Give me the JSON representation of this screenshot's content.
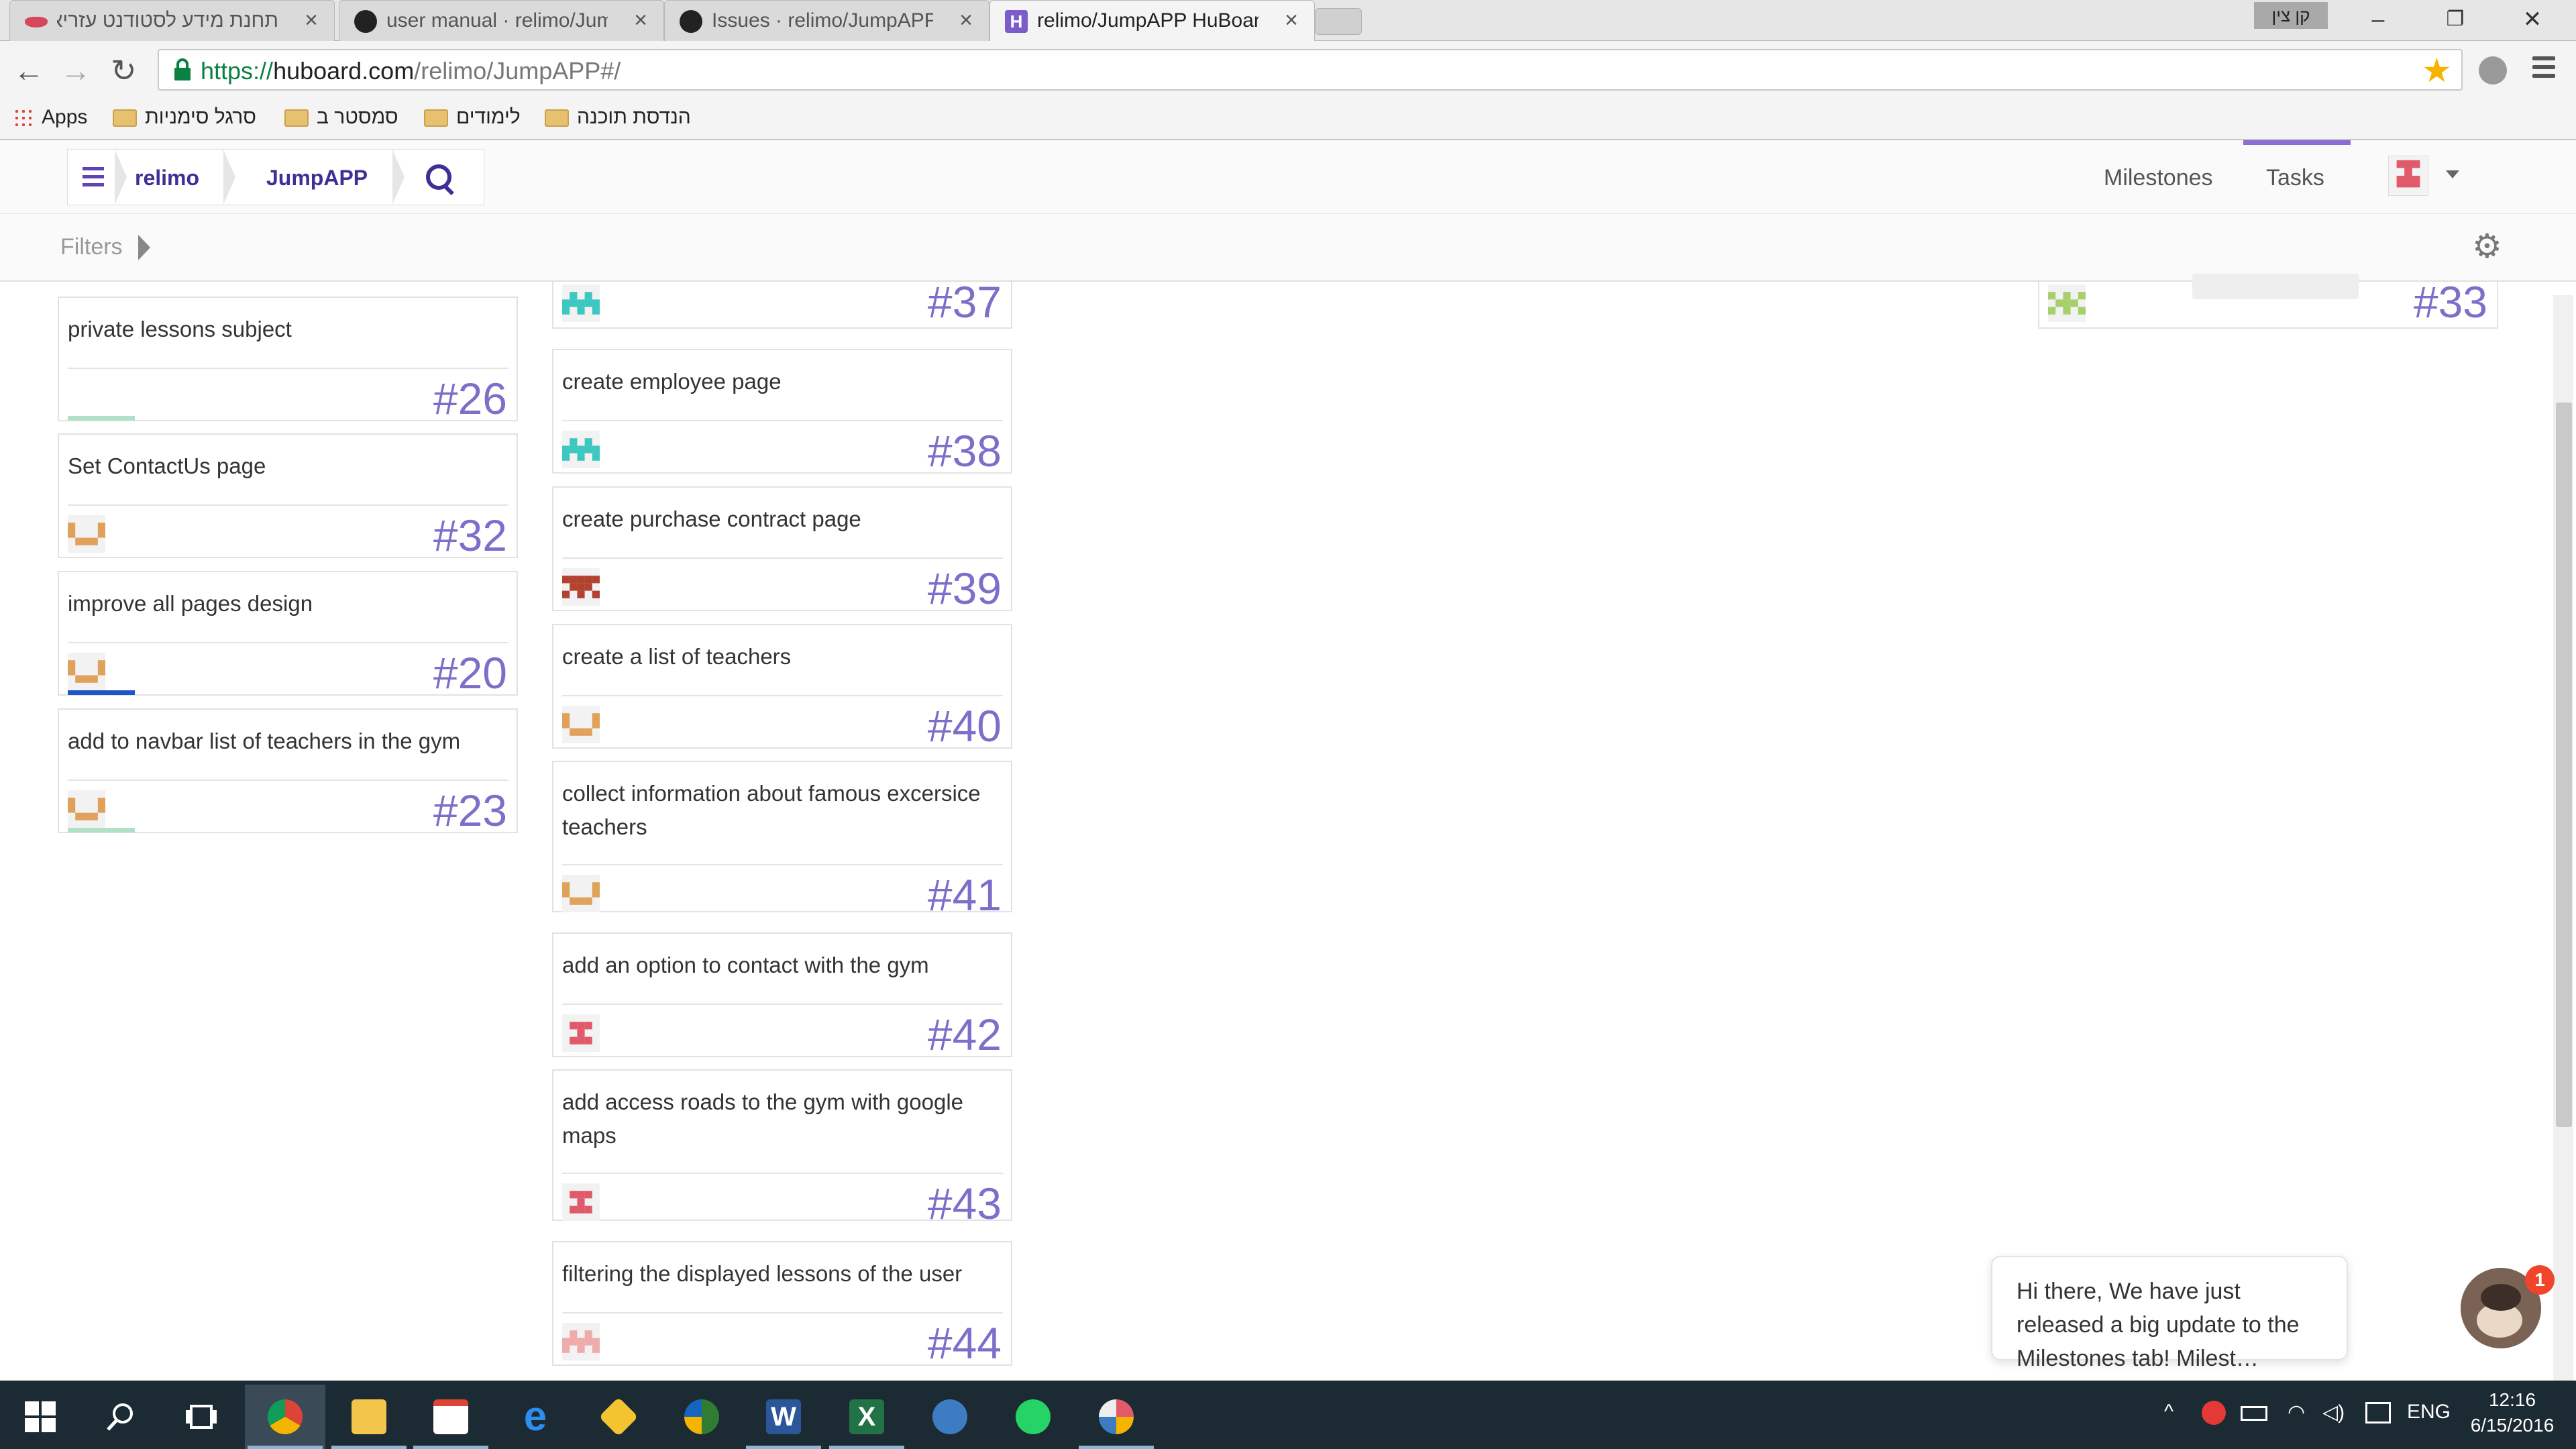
{
  "browser": {
    "tabs": [
      {
        "title": "תחנת מידע לסטודנט עזריא",
        "icon_color": "#d6475c"
      },
      {
        "title": "user manual · relimo/Jump",
        "icon_color": "#222222"
      },
      {
        "title": "Issues · relimo/JumpAPP",
        "icon_color": "#222222"
      },
      {
        "title": "relimo/JumpAPP HuBoard",
        "icon_color": "#7b5cc9"
      }
    ],
    "tab_close": "×",
    "profile_name": "קן צין",
    "window_buttons": {
      "minimize": "–",
      "restore": "❐",
      "close": "✕"
    },
    "nav": {
      "back": "←",
      "forward": "→",
      "reload": "↻"
    },
    "url": {
      "protocol": "https://",
      "host": "huboard.com",
      "path": "/relimo/JumpAPP#/"
    },
    "star": "★",
    "bookmarks": [
      {
        "label": "Apps"
      },
      {
        "label": "סרגל סימניות"
      },
      {
        "label": "סמסטר ב"
      },
      {
        "label": "לימודים"
      },
      {
        "label": "הנדסת תוכנה"
      }
    ]
  },
  "app": {
    "breadcrumb": {
      "owner": "relimo",
      "repo": "JumpAPP"
    },
    "nav": {
      "milestones": "Milestones",
      "tasks": "Tasks"
    },
    "filters_label": "Filters",
    "gear": "⚙",
    "accent": "#7e6ec9"
  },
  "board": {
    "column1": [
      {
        "title": "private lessons subject",
        "number": "#26",
        "avatar": "none",
        "bar_color": "#b2e0c6"
      },
      {
        "title": "Set ContactUs page",
        "number": "#32",
        "avatar": "orange",
        "bar_color": ""
      },
      {
        "title": "improve all pages design",
        "number": "#20",
        "avatar": "orange",
        "bar_color": "#1e55c8"
      },
      {
        "title": "add to navbar list of teachers in the gym",
        "number": "#23",
        "avatar": "orange",
        "bar_color": "#b2e0c6"
      }
    ],
    "column2": [
      {
        "title": "",
        "number": "#37",
        "avatar": "teal"
      },
      {
        "title": "create employee page",
        "number": "#38",
        "avatar": "teal"
      },
      {
        "title": "create purchase contract page",
        "number": "#39",
        "avatar": "darkred"
      },
      {
        "title": "create a list of teachers",
        "number": "#40",
        "avatar": "orange"
      },
      {
        "title": "collect information about famous excersice teachers",
        "number": "#41",
        "avatar": "orange"
      },
      {
        "title": "add an option to contact with the gym",
        "number": "#42",
        "avatar": "red"
      },
      {
        "title": "add access roads to the gym with google maps",
        "number": "#43",
        "avatar": "red"
      },
      {
        "title": "filtering the displayed lessons of the user",
        "number": "#44",
        "avatar": "pink"
      }
    ],
    "column4": [
      {
        "title": "",
        "number": "#33",
        "avatar": "green"
      }
    ]
  },
  "chat": {
    "message": "Hi there, We have just released a big update to the Milestones tab!  Milest…",
    "badge": "1"
  },
  "taskbar": {
    "language": "ENG",
    "time": "12:16",
    "date": "6/15/2016"
  }
}
